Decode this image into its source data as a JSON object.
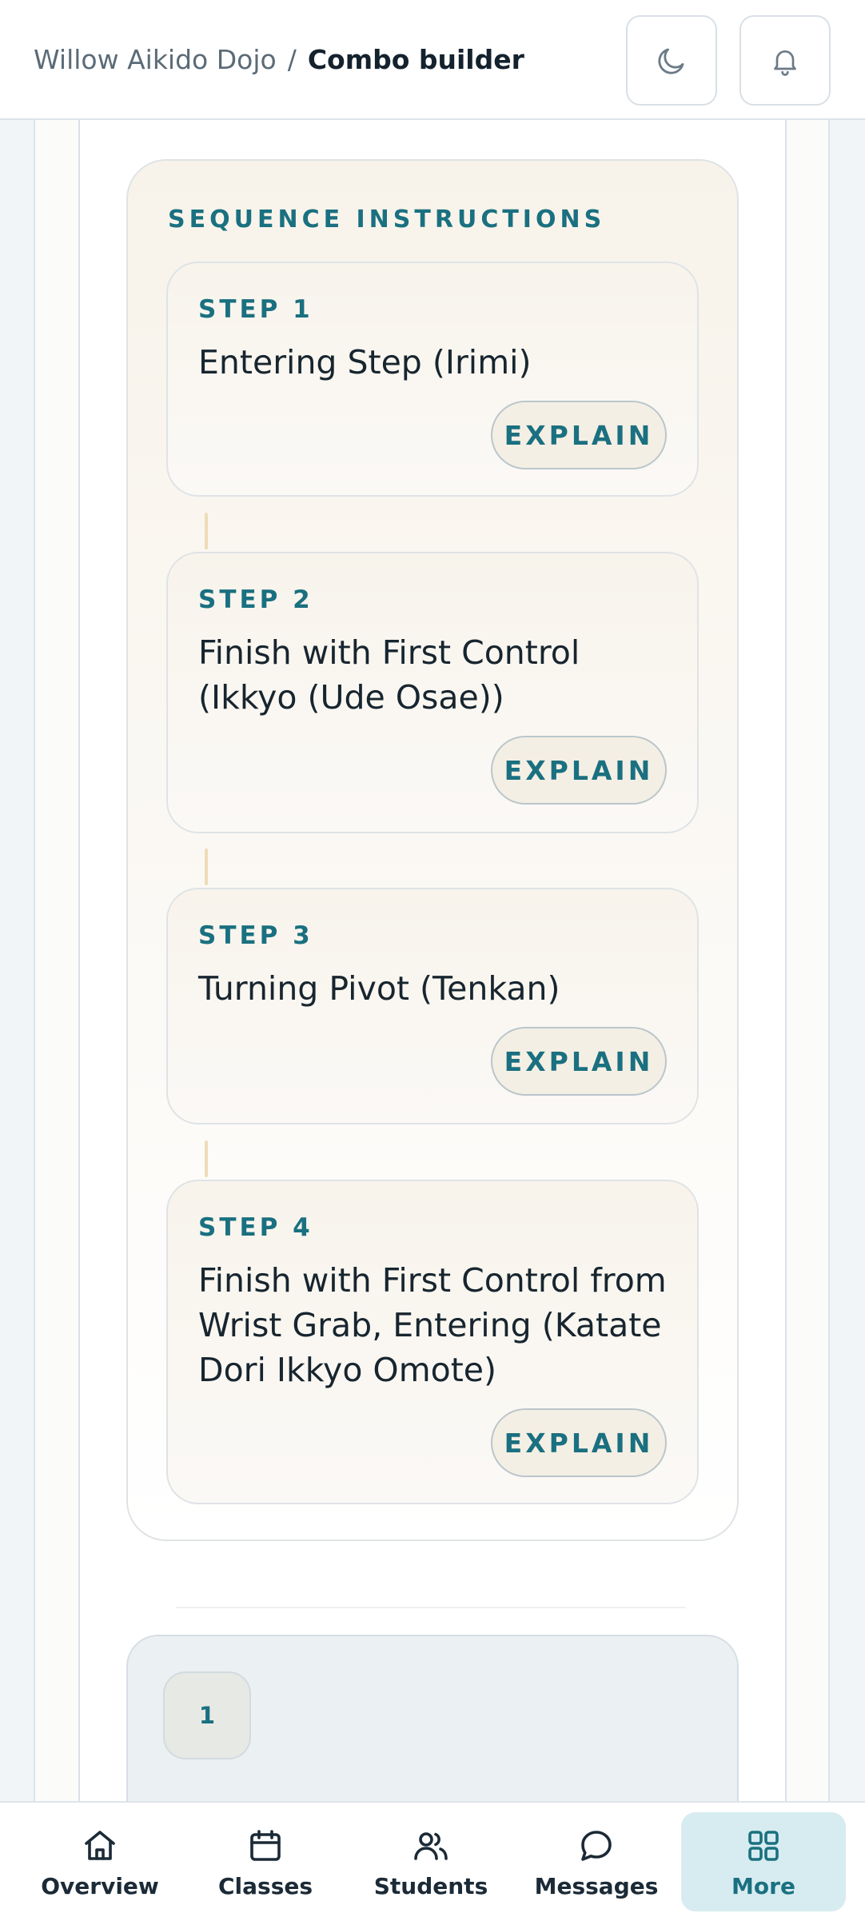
{
  "header": {
    "breadcrumb_home": "Willow Aikido Dojo",
    "breadcrumb_separator": "/",
    "breadcrumb_current": "Combo builder",
    "theme_toggle_icon": "moon-icon",
    "notifications_icon": "bell-icon"
  },
  "sequence": {
    "title": "SEQUENCE INSTRUCTIONS",
    "steps": [
      {
        "label": "STEP 1",
        "name": "Entering Step (Irimi)",
        "action": "EXPLAIN"
      },
      {
        "label": "STEP 2",
        "name": "Finish with First Control (Ikkyo (Ude Osae))",
        "action": "EXPLAIN"
      },
      {
        "label": "STEP 3",
        "name": "Turning Pivot (Tenkan)",
        "action": "EXPLAIN"
      },
      {
        "label": "STEP 4",
        "name": "Finish with First Control from Wrist Grab, Entering (Katate Dori Ikkyo Omote)",
        "action": "EXPLAIN"
      }
    ]
  },
  "next_panel": {
    "chip": "1"
  },
  "nav": {
    "items": [
      {
        "label": "Overview",
        "icon": "home-icon"
      },
      {
        "label": "Classes",
        "icon": "calendar-icon"
      },
      {
        "label": "Students",
        "icon": "users-icon"
      },
      {
        "label": "Messages",
        "icon": "message-icon"
      },
      {
        "label": "More",
        "icon": "grid-icon",
        "active": true
      }
    ]
  },
  "colors": {
    "accent": "#1a7080",
    "active_nav_bg": "#d7ecf0",
    "connector": "#eedcb8"
  }
}
